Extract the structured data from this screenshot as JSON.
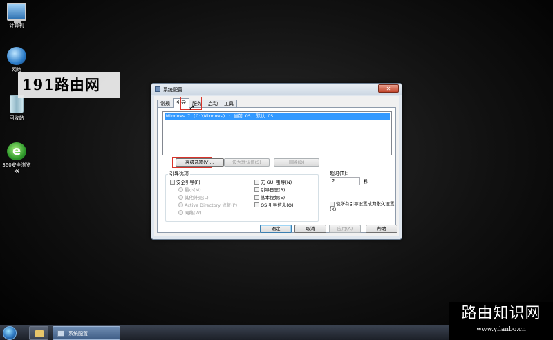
{
  "desktop": {
    "icons": [
      {
        "label": "计算机",
        "icon": "computer-icon"
      },
      {
        "label": "网络",
        "icon": "network-icon"
      },
      {
        "label": "回收站",
        "icon": "recycle-bin-icon"
      },
      {
        "label": "360安全浏览器",
        "icon": "360-browser-icon"
      }
    ],
    "watermark_top": "191路由网",
    "watermark_bottom": {
      "title": "路由知识网",
      "url": "www.yilanbo.cn"
    }
  },
  "dialog": {
    "title": "系统配置",
    "close_label": "✕",
    "tabs": [
      "常规",
      "引导",
      "服务",
      "启动",
      "工具"
    ],
    "active_tab": "引导",
    "boot_entries": [
      "Windows 7 (C:\\Windows) : 当前 OS; 默认 OS"
    ],
    "buttons": {
      "advanced": "高级选项(V)...",
      "set_default": "设为默认值(S)",
      "delete": "删除(D)"
    },
    "boot_options": {
      "title": "引导选项",
      "safe_boot": "安全引导(F)",
      "minimal": "最小(M)",
      "alternate_shell": "其他外壳(L)",
      "ad_repair": "Active Directory 修复(P)",
      "network": "网络(W)",
      "no_gui": "无 GUI 引导(N)",
      "boot_log": "引导日志(B)",
      "base_video": "基本视频(E)",
      "os_info": "OS 引导信息(O)"
    },
    "timeout": {
      "label": "超时(T):",
      "value": "2",
      "unit": "秒"
    },
    "make_permanent": "使所有引导设置成为永久设置(K)",
    "footer": {
      "ok": "确定",
      "cancel": "取消",
      "apply": "应用(A)",
      "help": "帮助"
    }
  },
  "taskbar": {
    "task_label": "系统配置"
  }
}
